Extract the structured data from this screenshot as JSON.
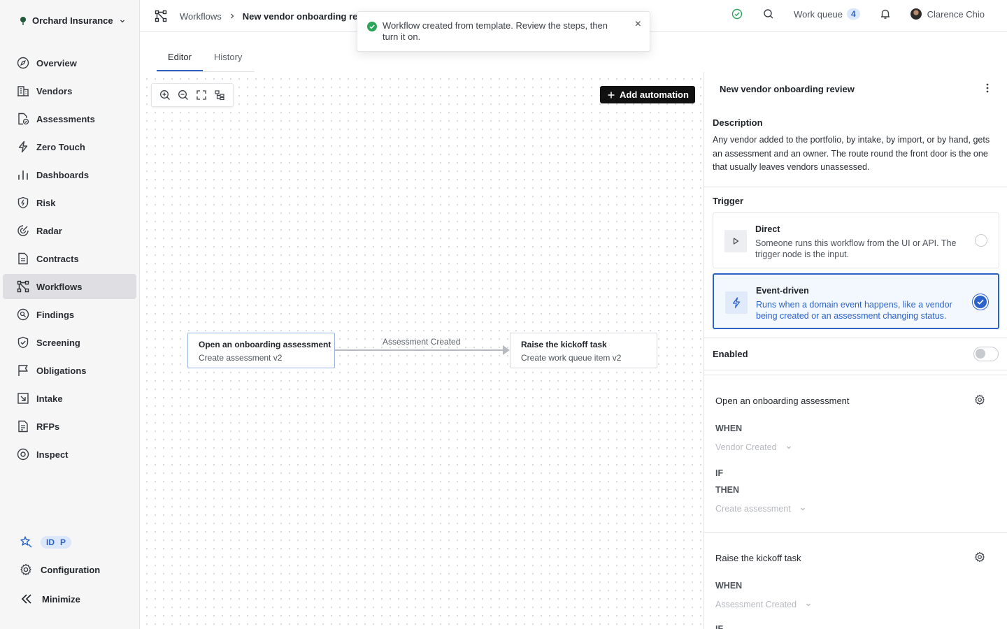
{
  "org": {
    "name": "Orchard Insurance"
  },
  "sidebar": {
    "items": [
      {
        "label": "Overview",
        "icon": "compass-icon"
      },
      {
        "label": "Vendors",
        "icon": "building-icon"
      },
      {
        "label": "Assessments",
        "icon": "document-check-icon"
      },
      {
        "label": "Zero Touch",
        "icon": "bolt-icon"
      },
      {
        "label": "Dashboards",
        "icon": "bar-chart-icon"
      },
      {
        "label": "Risk",
        "icon": "shield-bolt-icon"
      },
      {
        "label": "Radar",
        "icon": "radar-icon"
      },
      {
        "label": "Contracts",
        "icon": "document-icon"
      },
      {
        "label": "Workflows",
        "icon": "workflow-icon",
        "active": true
      },
      {
        "label": "Findings",
        "icon": "magnifier-doc-icon"
      },
      {
        "label": "Screening",
        "icon": "shield-check-icon"
      },
      {
        "label": "Obligations",
        "icon": "flag-icon"
      },
      {
        "label": "Intake",
        "icon": "inbox-arrow-icon"
      },
      {
        "label": "RFPs",
        "icon": "file-text-icon"
      },
      {
        "label": "Inspect",
        "icon": "eye-icon"
      }
    ],
    "badge": {
      "left": "ID",
      "right": "P"
    },
    "configuration": "Configuration",
    "minimize": "Minimize"
  },
  "header": {
    "breadcrumb_root": "Workflows",
    "breadcrumb_current": "New vendor onboarding review",
    "work_queue_label": "Work queue",
    "work_queue_count": "4",
    "user_name": "Clarence Chio"
  },
  "toast": {
    "message": "Workflow created from template. Review the steps, then turn it on."
  },
  "tabs": [
    {
      "label": "Editor",
      "active": true
    },
    {
      "label": "History"
    }
  ],
  "canvas": {
    "add_automation": "Add automation",
    "nodes": [
      {
        "title": "Open an onboarding assessment",
        "subtitle": "Create assessment v2"
      },
      {
        "title": "Raise the kickoff task",
        "subtitle": "Create work queue item v2"
      }
    ],
    "edge_label": "Assessment Created"
  },
  "panel": {
    "title": "New vendor onboarding review",
    "description_heading": "Description",
    "description": "Any vendor added to the portfolio, by intake, by import, or by hand, gets an assessment and an owner. The route round the front door is the one that usually leaves vendors unassessed.",
    "trigger_heading": "Trigger",
    "triggers": [
      {
        "title": "Direct",
        "desc": "Someone runs this workflow from the UI or API. The trigger node is the input.",
        "selected": false
      },
      {
        "title": "Event-driven",
        "desc": "Runs when a domain event happens, like a vendor being created or an assessment changing status.",
        "selected": true
      }
    ],
    "enabled_label": "Enabled",
    "enabled": false,
    "steps": [
      {
        "title": "Open an onboarding assessment",
        "when": "WHEN",
        "when_value": "Vendor Created",
        "if": "IF",
        "then": "THEN",
        "then_value": "Create assessment"
      },
      {
        "title": "Raise the kickoff task",
        "when": "WHEN",
        "when_value": "Assessment Created",
        "if": "IF"
      }
    ]
  }
}
